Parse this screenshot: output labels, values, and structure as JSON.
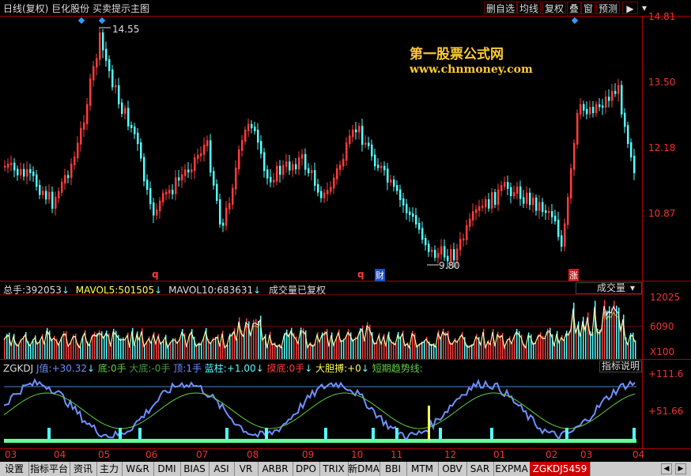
{
  "header": {
    "title": "日线(复权)  巨化股份  买卖提示主图",
    "buttons": [
      "删自选",
      "均线",
      "复权",
      "叠",
      "窗",
      "预测"
    ],
    "menu_icon": "arrow-right-bar-icon"
  },
  "watermark": {
    "line1": "第一股票公式网",
    "line2": "www.chnmoney.com"
  },
  "price_panel": {
    "axis_labels": [
      "14.81",
      "13.50",
      "12.18",
      "10.87"
    ],
    "high_label": "14.55",
    "low_label": "9.80",
    "markers": [
      "q",
      "q",
      "财",
      "涨"
    ]
  },
  "volume_panel": {
    "total_label": "总手:",
    "total_value": "392053",
    "mavol5_label": "MAVOL5:",
    "mavol5_value": "501505",
    "mavol10_label": "MAVOL10:",
    "mavol10_value": "683631",
    "note": "成交量已复权",
    "dropdown_label": "成交量",
    "axis_labels": [
      "12025",
      "6090",
      "X100"
    ]
  },
  "kdj_panel": {
    "name": "ZGKDJ",
    "j_label": "J值:",
    "j_value": "+30.32",
    "di_label": "底:",
    "di_value": "0手",
    "dadi_label": "大底:",
    "dadi_value": "-0手",
    "ding_label": "顶:",
    "ding_value": "1手",
    "lanzhu_label": "蓝柱:",
    "lanzhu_value": "+1.00",
    "modi_label": "摸底:",
    "modi_value": "0手",
    "dadan_label": "大胆搏:",
    "dadan_value": "+0",
    "trend_label": "短期趋势线:",
    "help_button": "指标说明",
    "axis_labels": [
      "+111.6",
      "+51.66"
    ]
  },
  "x_axis_labels": [
    "03",
    "04",
    "05",
    "06",
    "07",
    "08",
    "09",
    "10",
    "11",
    "12",
    "01",
    "02",
    "03",
    "04"
  ],
  "tabs": [
    "设置",
    "指标平台",
    "资讯",
    "主力",
    "W&R",
    "DMI",
    "BIAS",
    "ASI",
    "VR",
    "ARBR",
    "DPO",
    "TRIX",
    "新DMA",
    "BBI",
    "MTM",
    "OBV",
    "SAR",
    "EXPMA",
    "ZGKDJ5459"
  ],
  "colors": {
    "up": "#ff3c3c",
    "down": "#54ffff",
    "border": "#aa0000",
    "kdj_j": "#6f8fff",
    "kdj_k": "#5fcf3f",
    "active_tab": "#cc0000"
  }
}
